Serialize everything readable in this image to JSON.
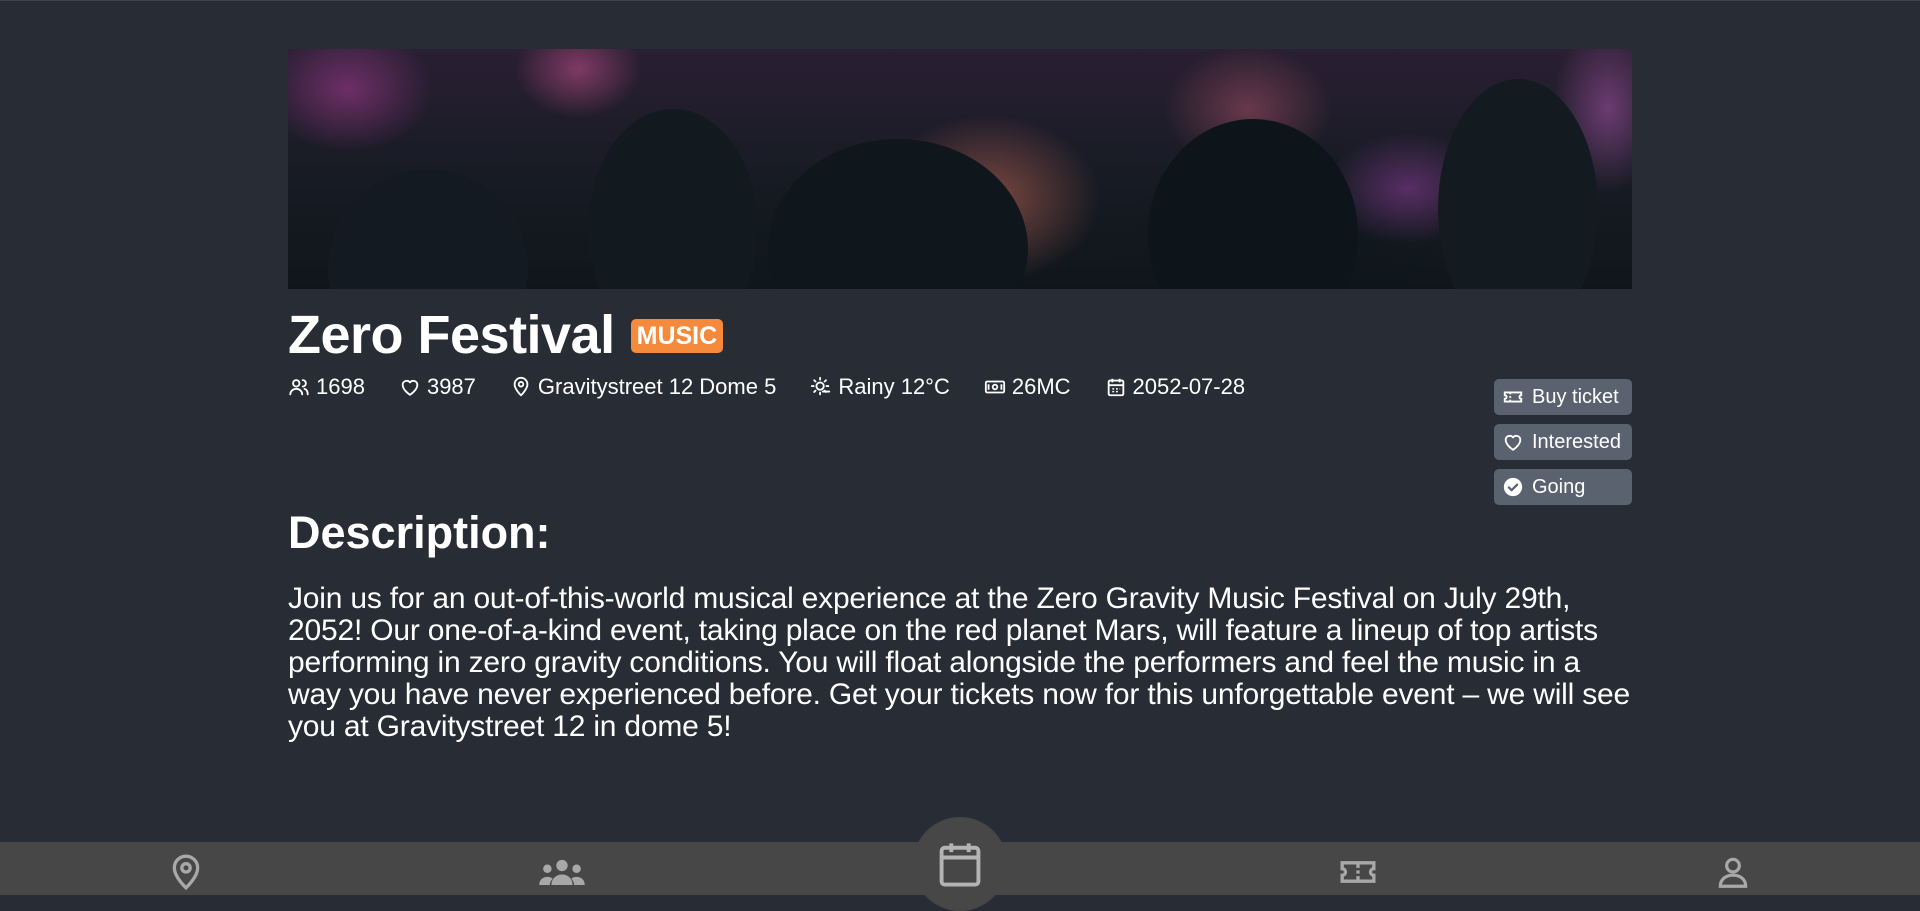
{
  "event": {
    "title": "Zero Festival",
    "category": "MUSIC",
    "hero_icon": "concert-crowd-image"
  },
  "meta": {
    "attendees": "1698",
    "likes": "3987",
    "location": "Gravitystreet 12 Dome 5",
    "weather": "Rainy 12°C",
    "price": "26MC",
    "date": "2052-07-28"
  },
  "actions": {
    "buy_ticket": "Buy ticket",
    "interested": "Interested",
    "going": "Going"
  },
  "description": {
    "heading": "Description:",
    "text": "Join us for an out-of-this-world musical experience at the Zero Gravity Music Festival on July 29th, 2052! Our one-of-a-kind event, taking place on the red planet Mars, will feature a lineup of top artists performing in zero gravity conditions. You will float alongside the performers and feel the music in a way you have never experienced before. Get your tickets now for this unforgettable event – we will see you at Gravitystreet 12 in dome 5!"
  },
  "nav": {
    "items": [
      "map-pin-icon",
      "people-icon",
      "calendar-icon",
      "ticket-icon",
      "user-icon"
    ],
    "active": "calendar-icon"
  },
  "colors": {
    "background": "#282c34",
    "badge": "#f58a3c",
    "button": "#5a6270",
    "nav": "#474747"
  }
}
